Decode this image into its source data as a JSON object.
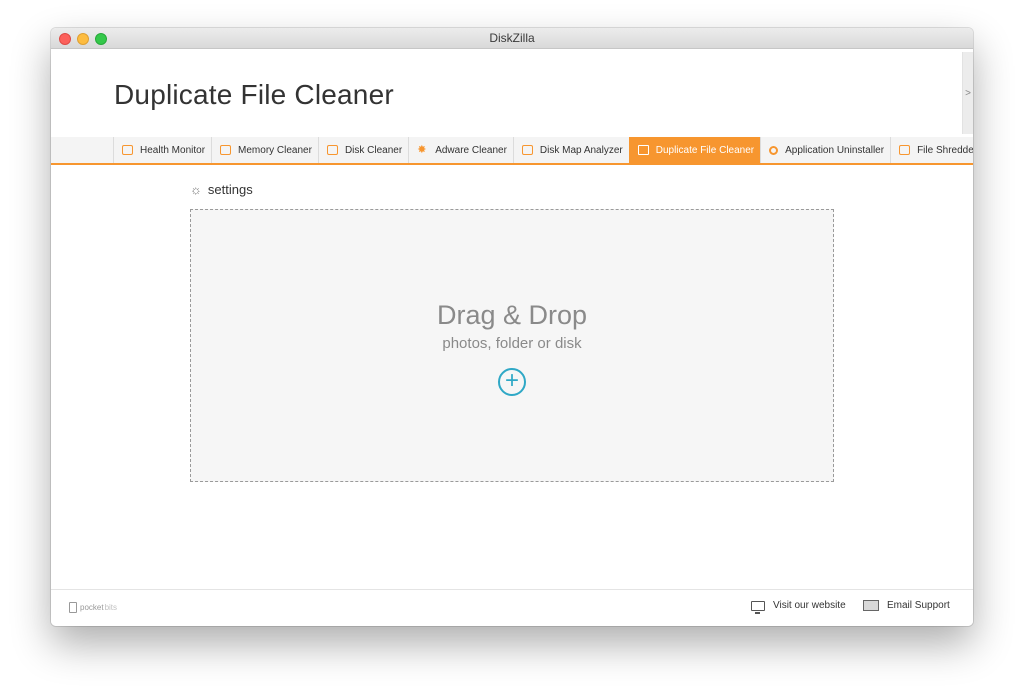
{
  "window": {
    "title": "DiskZilla"
  },
  "header": {
    "page_title": "Duplicate File Cleaner",
    "side_arrow": ">"
  },
  "tabs": [
    {
      "label": "Health Monitor",
      "icon": "list-icon"
    },
    {
      "label": "Memory Cleaner",
      "icon": "monitor-icon"
    },
    {
      "label": "Disk Cleaner",
      "icon": "disk-icon"
    },
    {
      "label": "Adware Cleaner",
      "icon": "bug-icon"
    },
    {
      "label": "Disk Map Analyzer",
      "icon": "chart-icon"
    },
    {
      "label": "Duplicate File Cleaner",
      "icon": "duplicate-icon",
      "active": true
    },
    {
      "label": "Application Uninstaller",
      "icon": "gear-icon"
    },
    {
      "label": "File Shredder",
      "icon": "shredder-icon"
    }
  ],
  "settings": {
    "label": "settings"
  },
  "dropzone": {
    "title": "Drag & Drop",
    "subtitle": "photos, folder or disk",
    "plus": "+"
  },
  "footer": {
    "brand_left": "pocket",
    "brand_right": "bits",
    "visit_website": "Visit our website",
    "email_support": "Email Support"
  },
  "colors": {
    "accent": "#f7962f",
    "plus": "#2fa8c6"
  }
}
